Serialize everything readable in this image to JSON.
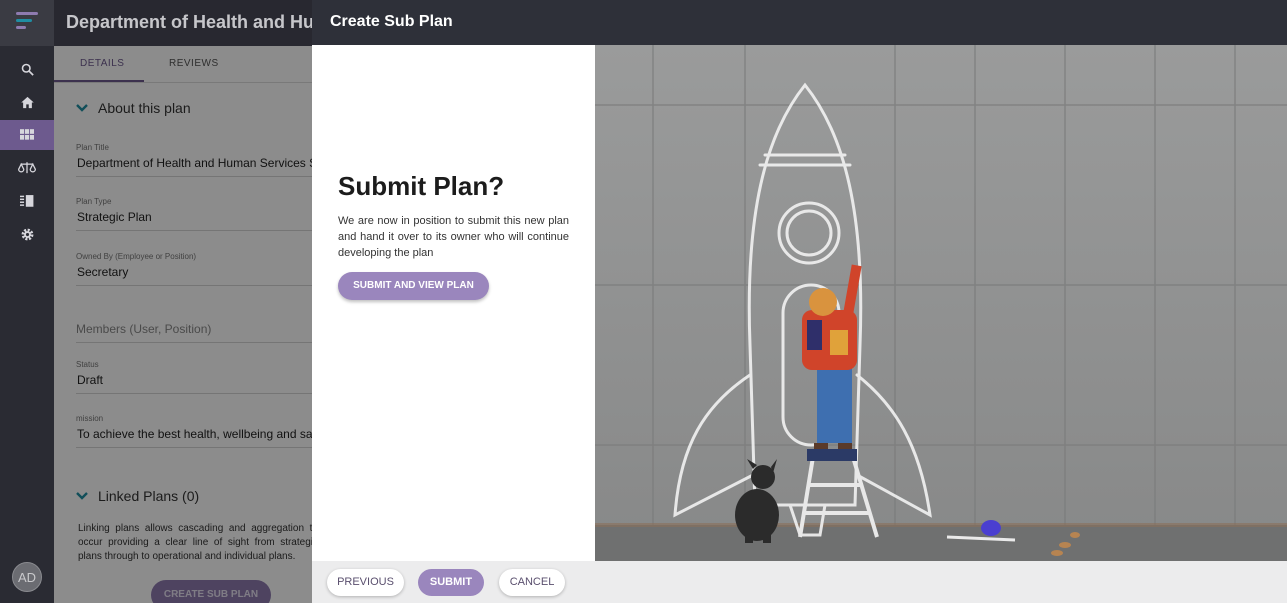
{
  "nav": {
    "avatar_initials": "AD",
    "icons": [
      "menu-logo-icon",
      "search-icon",
      "home-icon",
      "grid-icon",
      "scales-icon",
      "book-icon",
      "gear-icon"
    ]
  },
  "page": {
    "title": "Department of Health and Human Services",
    "tabs": [
      "DETAILS",
      "REVIEWS"
    ],
    "about_heading": "About this plan",
    "fields": {
      "plan_title_label": "Plan Title",
      "plan_title_value": "Department of Health and Human Services Strategic Plan",
      "plan_type_label": "Plan Type",
      "plan_type_value": "Strategic Plan",
      "owned_by_label": "Owned By (Employee or Position)",
      "owned_by_value": "Secretary",
      "members_placeholder": "Members (User, Position)",
      "status_label": "Status",
      "status_value": "Draft",
      "mission_label": "mission",
      "mission_value": "To achieve the best health, wellbeing and safety"
    },
    "linked_heading": "Linked Plans (0)",
    "linked_text": "Linking plans allows cascading and aggregation to occur providing a clear line of sight from strategic plans through to operational and individual plans.",
    "create_sub_plan_label": "CREATE SUB PLAN"
  },
  "modal": {
    "header": "Create Sub Plan",
    "title": "Submit Plan?",
    "text": "We are now in position to submit this new plan and hand it over to its owner who will continue developing the plan",
    "submit_view_label": "SUBMIT AND VIEW PLAN",
    "footer": {
      "previous_label": "PREVIOUS",
      "submit_label": "SUBMIT",
      "cancel_label": "CANCEL"
    }
  },
  "colors": {
    "accent": "#9a86bd",
    "header": "#2e3039",
    "rail": "#2a2b33"
  }
}
